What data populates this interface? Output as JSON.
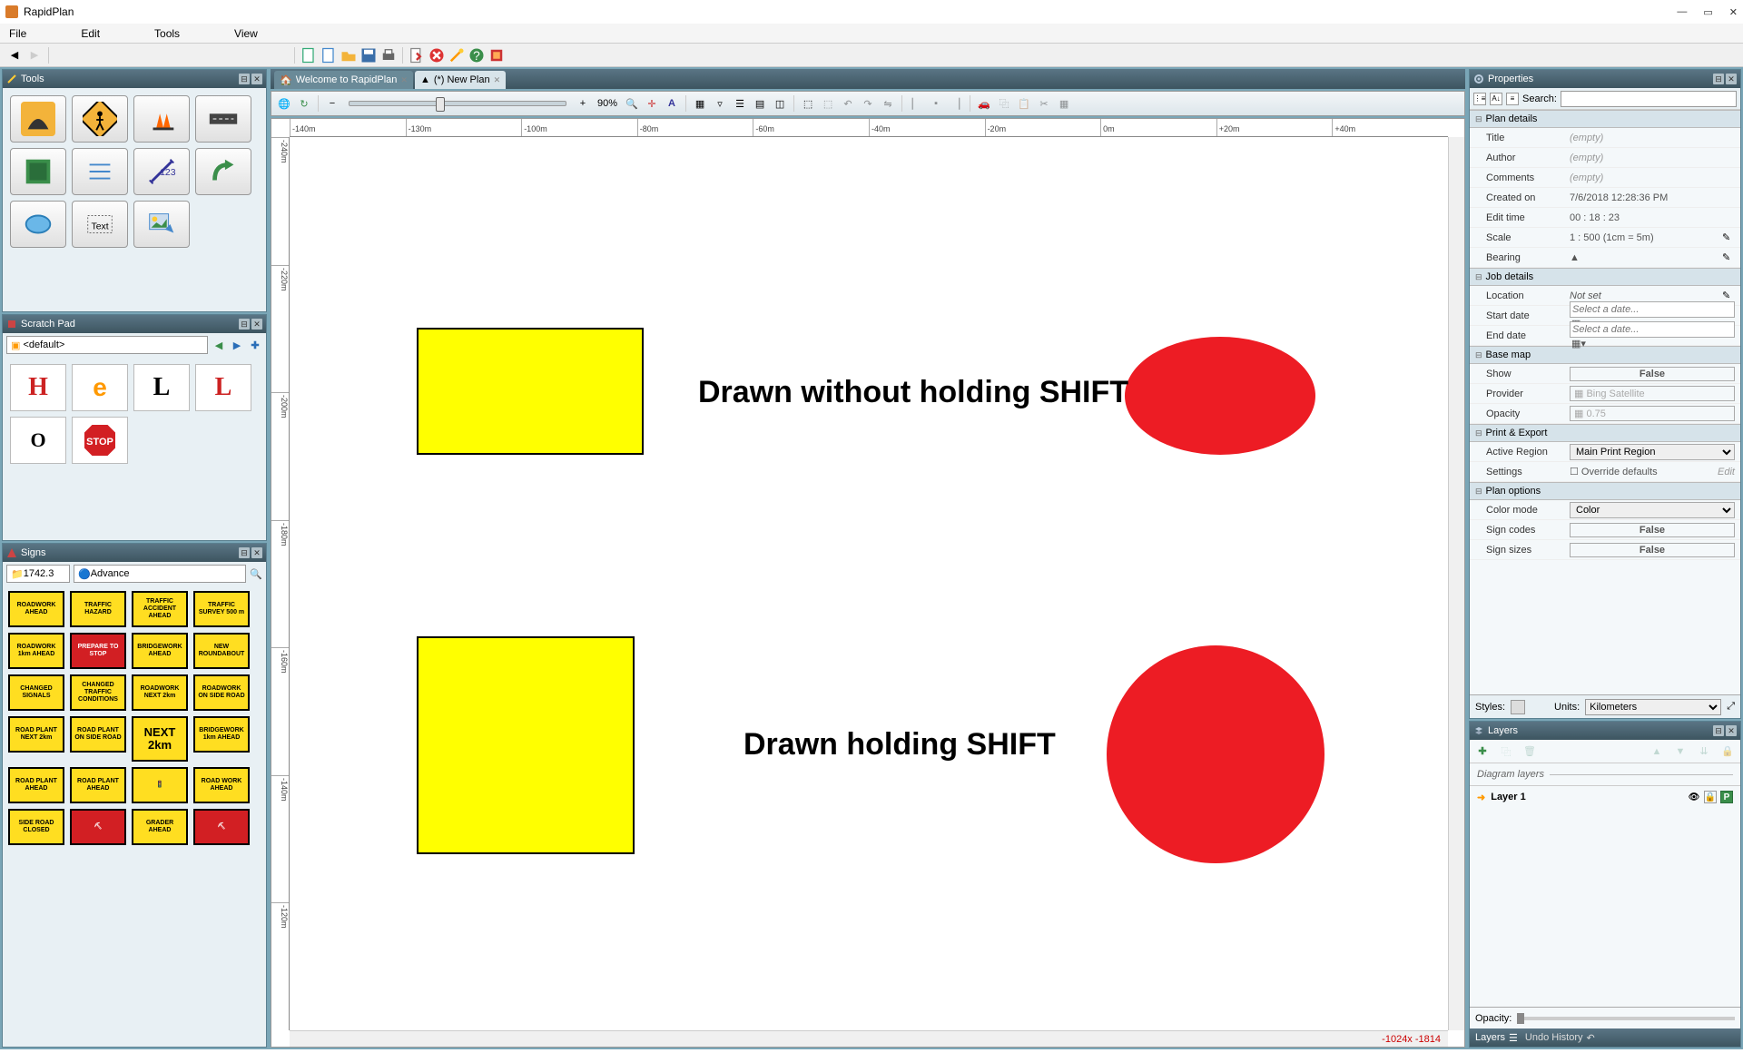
{
  "window": {
    "title": "RapidPlan",
    "min": "—",
    "max": "▭",
    "close": "✕"
  },
  "menu": [
    "File",
    "Edit",
    "Tools",
    "View"
  ],
  "tabs": [
    {
      "label": "Welcome to RapidPlan",
      "active": false
    },
    {
      "label": "(*) New Plan",
      "active": true
    }
  ],
  "zoom": "90%",
  "ruler_h": [
    "-140m",
    "-130m",
    "-100m",
    "-80m",
    "-60m",
    "-40m",
    "-20m",
    "0m",
    "+20m",
    "+40m"
  ],
  "ruler_v": [
    "-240m",
    "-220m",
    "-200m",
    "-180m",
    "-160m",
    "-140m",
    "-120m"
  ],
  "canvas": {
    "text1": "Drawn without holding SHIFT",
    "text2": "Drawn holding SHIFT",
    "coords": "-1024x -1814"
  },
  "tools_panel": {
    "title": "Tools"
  },
  "scratch": {
    "title": "Scratch Pad",
    "selector": "<default>",
    "items": [
      "H",
      "e",
      "L",
      "L",
      "O",
      "STOP"
    ]
  },
  "signs": {
    "title": "Signs",
    "code": "1742.3",
    "category": "Advance",
    "items": [
      {
        "t": "ROADWORK AHEAD",
        "c": "y"
      },
      {
        "t": "TRAFFIC HAZARD",
        "c": "y"
      },
      {
        "t": "TRAFFIC ACCIDENT AHEAD",
        "c": "y"
      },
      {
        "t": "TRAFFIC SURVEY 500 m",
        "c": "y"
      },
      {
        "t": "ROADWORK 1km AHEAD",
        "c": "y"
      },
      {
        "t": "PREPARE TO STOP",
        "c": "r"
      },
      {
        "t": "BRIDGEWORK AHEAD",
        "c": "y"
      },
      {
        "t": "NEW ROUNDABOUT",
        "c": "y"
      },
      {
        "t": "CHANGED SIGNALS",
        "c": "y"
      },
      {
        "t": "CHANGED TRAFFIC CONDITIONS",
        "c": "y"
      },
      {
        "t": "ROADWORK NEXT 2km",
        "c": "y"
      },
      {
        "t": "ROADWORK ON SIDE ROAD",
        "c": "y"
      },
      {
        "t": "ROAD PLANT NEXT 2km",
        "c": "y"
      },
      {
        "t": "ROAD PLANT ON SIDE ROAD",
        "c": "y"
      },
      {
        "t": "NEXT 2km",
        "c": "y"
      },
      {
        "t": "BRIDGEWORK 1km AHEAD",
        "c": "y"
      },
      {
        "t": "ROAD PLANT AHEAD",
        "c": "y"
      },
      {
        "t": "ROAD PLANT AHEAD",
        "c": "y"
      },
      {
        "t": "🚦",
        "c": "y"
      },
      {
        "t": "ROAD WORK AHEAD",
        "c": "y"
      },
      {
        "t": "SIDE ROAD CLOSED",
        "c": "y"
      },
      {
        "t": "⛏",
        "c": "r"
      },
      {
        "t": "GRADER AHEAD",
        "c": "y"
      },
      {
        "t": "⛏",
        "c": "r"
      }
    ]
  },
  "properties": {
    "title": "Properties",
    "search_label": "Search:",
    "groups": [
      {
        "name": "Plan details",
        "rows": [
          {
            "k": "Title",
            "v": "(empty)",
            "empty": true
          },
          {
            "k": "Author",
            "v": "(empty)",
            "empty": true
          },
          {
            "k": "Comments",
            "v": "(empty)",
            "empty": true
          },
          {
            "k": "Created on",
            "v": "7/6/2018 12:28:36 PM"
          },
          {
            "k": "Edit time",
            "v": "00 : 18 : 23"
          },
          {
            "k": "Scale",
            "v": "1 : 500   (1cm = 5m)",
            "pencil": true
          },
          {
            "k": "Bearing",
            "v": "▲",
            "pencil": true
          }
        ]
      },
      {
        "name": "Job details",
        "rows": [
          {
            "k": "Location",
            "v": "Not set",
            "italic": true,
            "pencil": true
          },
          {
            "k": "Start date",
            "v": "Select a date...",
            "input": "date"
          },
          {
            "k": "End date",
            "v": "Select a date...",
            "input": "date"
          }
        ]
      },
      {
        "name": "Base map",
        "rows": [
          {
            "k": "Show",
            "v": "False",
            "center": true,
            "box": true
          },
          {
            "k": "Provider",
            "v": "Bing Satellite",
            "box": true,
            "dim": true
          },
          {
            "k": "Opacity",
            "v": "0.75",
            "box": true,
            "dim": true
          }
        ]
      },
      {
        "name": "Print & Export",
        "rows": [
          {
            "k": "Active Region",
            "v": "Main Print Region",
            "select": true
          },
          {
            "k": "Settings",
            "v": "Override defaults",
            "cb": true,
            "edit": true
          }
        ]
      },
      {
        "name": "Plan options",
        "rows": [
          {
            "k": "Color mode",
            "v": "Color",
            "select": true
          },
          {
            "k": "Sign codes",
            "v": "False",
            "center": true,
            "box": true
          },
          {
            "k": "Sign sizes",
            "v": "False",
            "center": true,
            "box": true
          }
        ]
      }
    ],
    "styles_label": "Styles:",
    "units_label": "Units:",
    "units_value": "Kilometers"
  },
  "layers": {
    "title": "Layers",
    "section": "Diagram layers",
    "layer1": "Layer 1",
    "opacity_label": "Opacity:",
    "bottom_tabs": [
      "Layers",
      "Undo History"
    ]
  }
}
